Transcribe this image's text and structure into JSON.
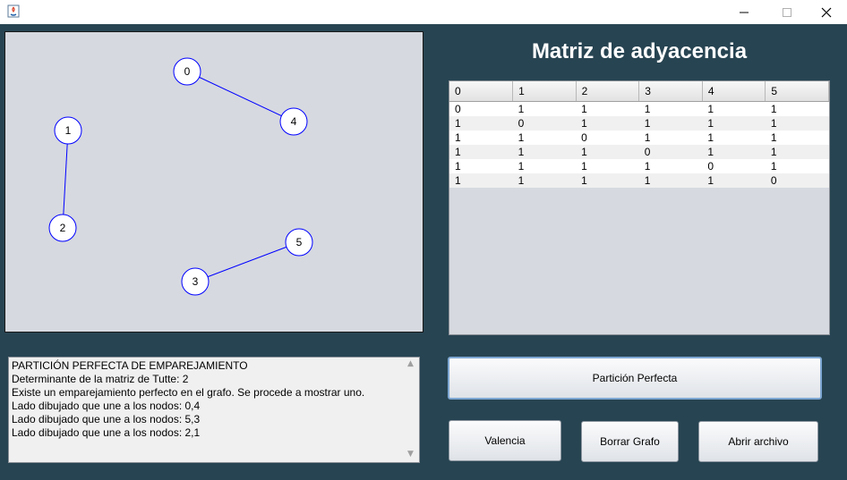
{
  "window": {
    "minimize": "—",
    "maximize": "☐",
    "close": "✕"
  },
  "graph": {
    "nodes": [
      {
        "label": "0"
      },
      {
        "label": "1"
      },
      {
        "label": "2"
      },
      {
        "label": "3"
      },
      {
        "label": "4"
      },
      {
        "label": "5"
      }
    ],
    "edges": [
      [
        "0",
        "4"
      ],
      [
        "5",
        "3"
      ],
      [
        "2",
        "1"
      ]
    ],
    "edge_color": "#0000ff"
  },
  "matrix": {
    "title": "Matriz de adyacencia",
    "headers": [
      "0",
      "1",
      "2",
      "3",
      "4",
      "5"
    ],
    "rows": [
      [
        "0",
        "1",
        "1",
        "1",
        "1",
        "1"
      ],
      [
        "1",
        "0",
        "1",
        "1",
        "1",
        "1"
      ],
      [
        "1",
        "1",
        "0",
        "1",
        "1",
        "1"
      ],
      [
        "1",
        "1",
        "1",
        "0",
        "1",
        "1"
      ],
      [
        "1",
        "1",
        "1",
        "1",
        "0",
        "1"
      ],
      [
        "1",
        "1",
        "1",
        "1",
        "1",
        "0"
      ]
    ]
  },
  "log": {
    "lines": [
      "PARTICIÓN PERFECTA DE EMPAREJAMIENTO",
      "Determinante de la matriz de Tutte: 2",
      "Existe un emparejamiento perfecto en el grafo. Se procede a mostrar uno.",
      "Lado dibujado que une a los nodos: 0,4",
      "Lado dibujado que une a los nodos: 5,3",
      "Lado dibujado que une a los nodos: 2,1"
    ]
  },
  "buttons": {
    "particion": "Partición Perfecta",
    "valencia": "Valencia",
    "borrar": "Borrar Grafo",
    "abrir": "Abrir archivo"
  }
}
